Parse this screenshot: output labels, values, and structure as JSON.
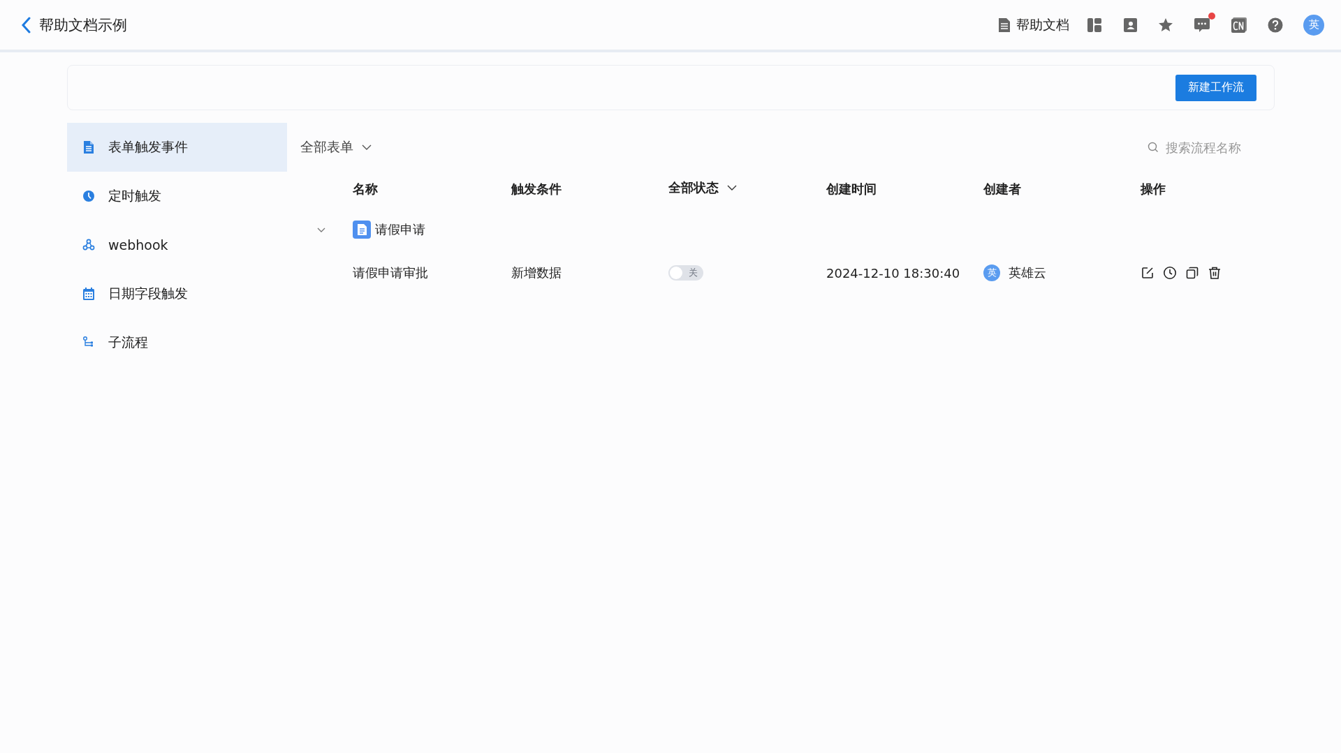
{
  "header": {
    "title": "帮助文档示例",
    "help_link": "帮助文档",
    "avatar": "英",
    "notification_dot": true
  },
  "toolbar": {
    "new_button": "新建工作流"
  },
  "sidebar": {
    "items": [
      {
        "label": "表单触发事件",
        "selected": true
      },
      {
        "label": "定时触发",
        "selected": false
      },
      {
        "label": "webhook",
        "selected": false
      },
      {
        "label": "日期字段触发",
        "selected": false
      },
      {
        "label": "子流程",
        "selected": false
      }
    ]
  },
  "filter": {
    "form_select": "全部表单",
    "search": {
      "placeholder": "搜索流程名称"
    }
  },
  "table": {
    "columns": [
      {
        "label": "名称",
        "kind": "text"
      },
      {
        "label": "触发条件",
        "kind": "text"
      },
      {
        "label": "全部状态",
        "kind": "dropdown"
      },
      {
        "label": "创建时间",
        "kind": "text"
      },
      {
        "label": "创建者",
        "kind": "text"
      },
      {
        "label": "操作",
        "kind": "text"
      }
    ],
    "groups": [
      {
        "name": "请假申请",
        "expanded": true,
        "rows": [
          {
            "name": "请假申请审批",
            "trigger": "新增数据",
            "status": {
              "on": false,
              "label": "关"
            },
            "created": "2024-12-10 18:30:40",
            "creator_avatar": "英",
            "creator": "英雄云"
          }
        ]
      }
    ]
  }
}
